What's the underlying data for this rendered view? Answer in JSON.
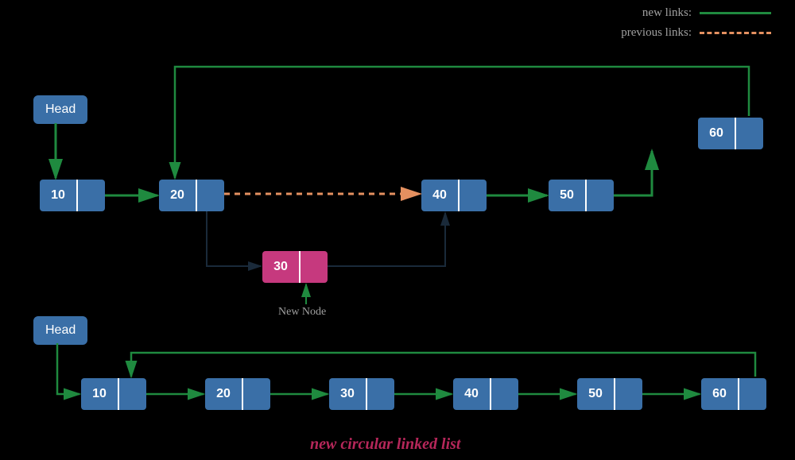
{
  "legend": {
    "new_links": "new links:",
    "previous_links": "previous links:"
  },
  "top": {
    "head_label": "Head",
    "nodes": {
      "n10": "10",
      "n20": "20",
      "n30": "30",
      "n40": "40",
      "n50": "50",
      "n60": "60"
    },
    "new_node_label": "New Node"
  },
  "bottom": {
    "head_label": "Head",
    "nodes": {
      "n10": "10",
      "n20": "20",
      "n30": "30",
      "n40": "40",
      "n50": "50",
      "n60": "60"
    },
    "caption": "new circular linked list"
  },
  "colors": {
    "node_blue": "#3a6fa7",
    "node_pink": "#c6397e",
    "arrow_green": "#1f8a3f",
    "arrow_dashed": "#e49060",
    "arrow_dark": "#1a2a3a",
    "caption": "#b6275a"
  },
  "chart_data": {
    "type": "diagram",
    "description": "Circular linked list insertion diagram",
    "upper_list_before_insert": [
      10,
      20,
      40,
      50,
      60
    ],
    "inserted_node": 30,
    "insert_after": 20,
    "removed_link": [
      20,
      40
    ],
    "added_links": [
      [
        20,
        30
      ],
      [
        30,
        40
      ]
    ],
    "resulting_list": [
      10,
      20,
      30,
      40,
      50,
      60
    ],
    "is_circular": true,
    "legend": {
      "new_links": "solid green",
      "previous_links": "dashed orange"
    }
  }
}
